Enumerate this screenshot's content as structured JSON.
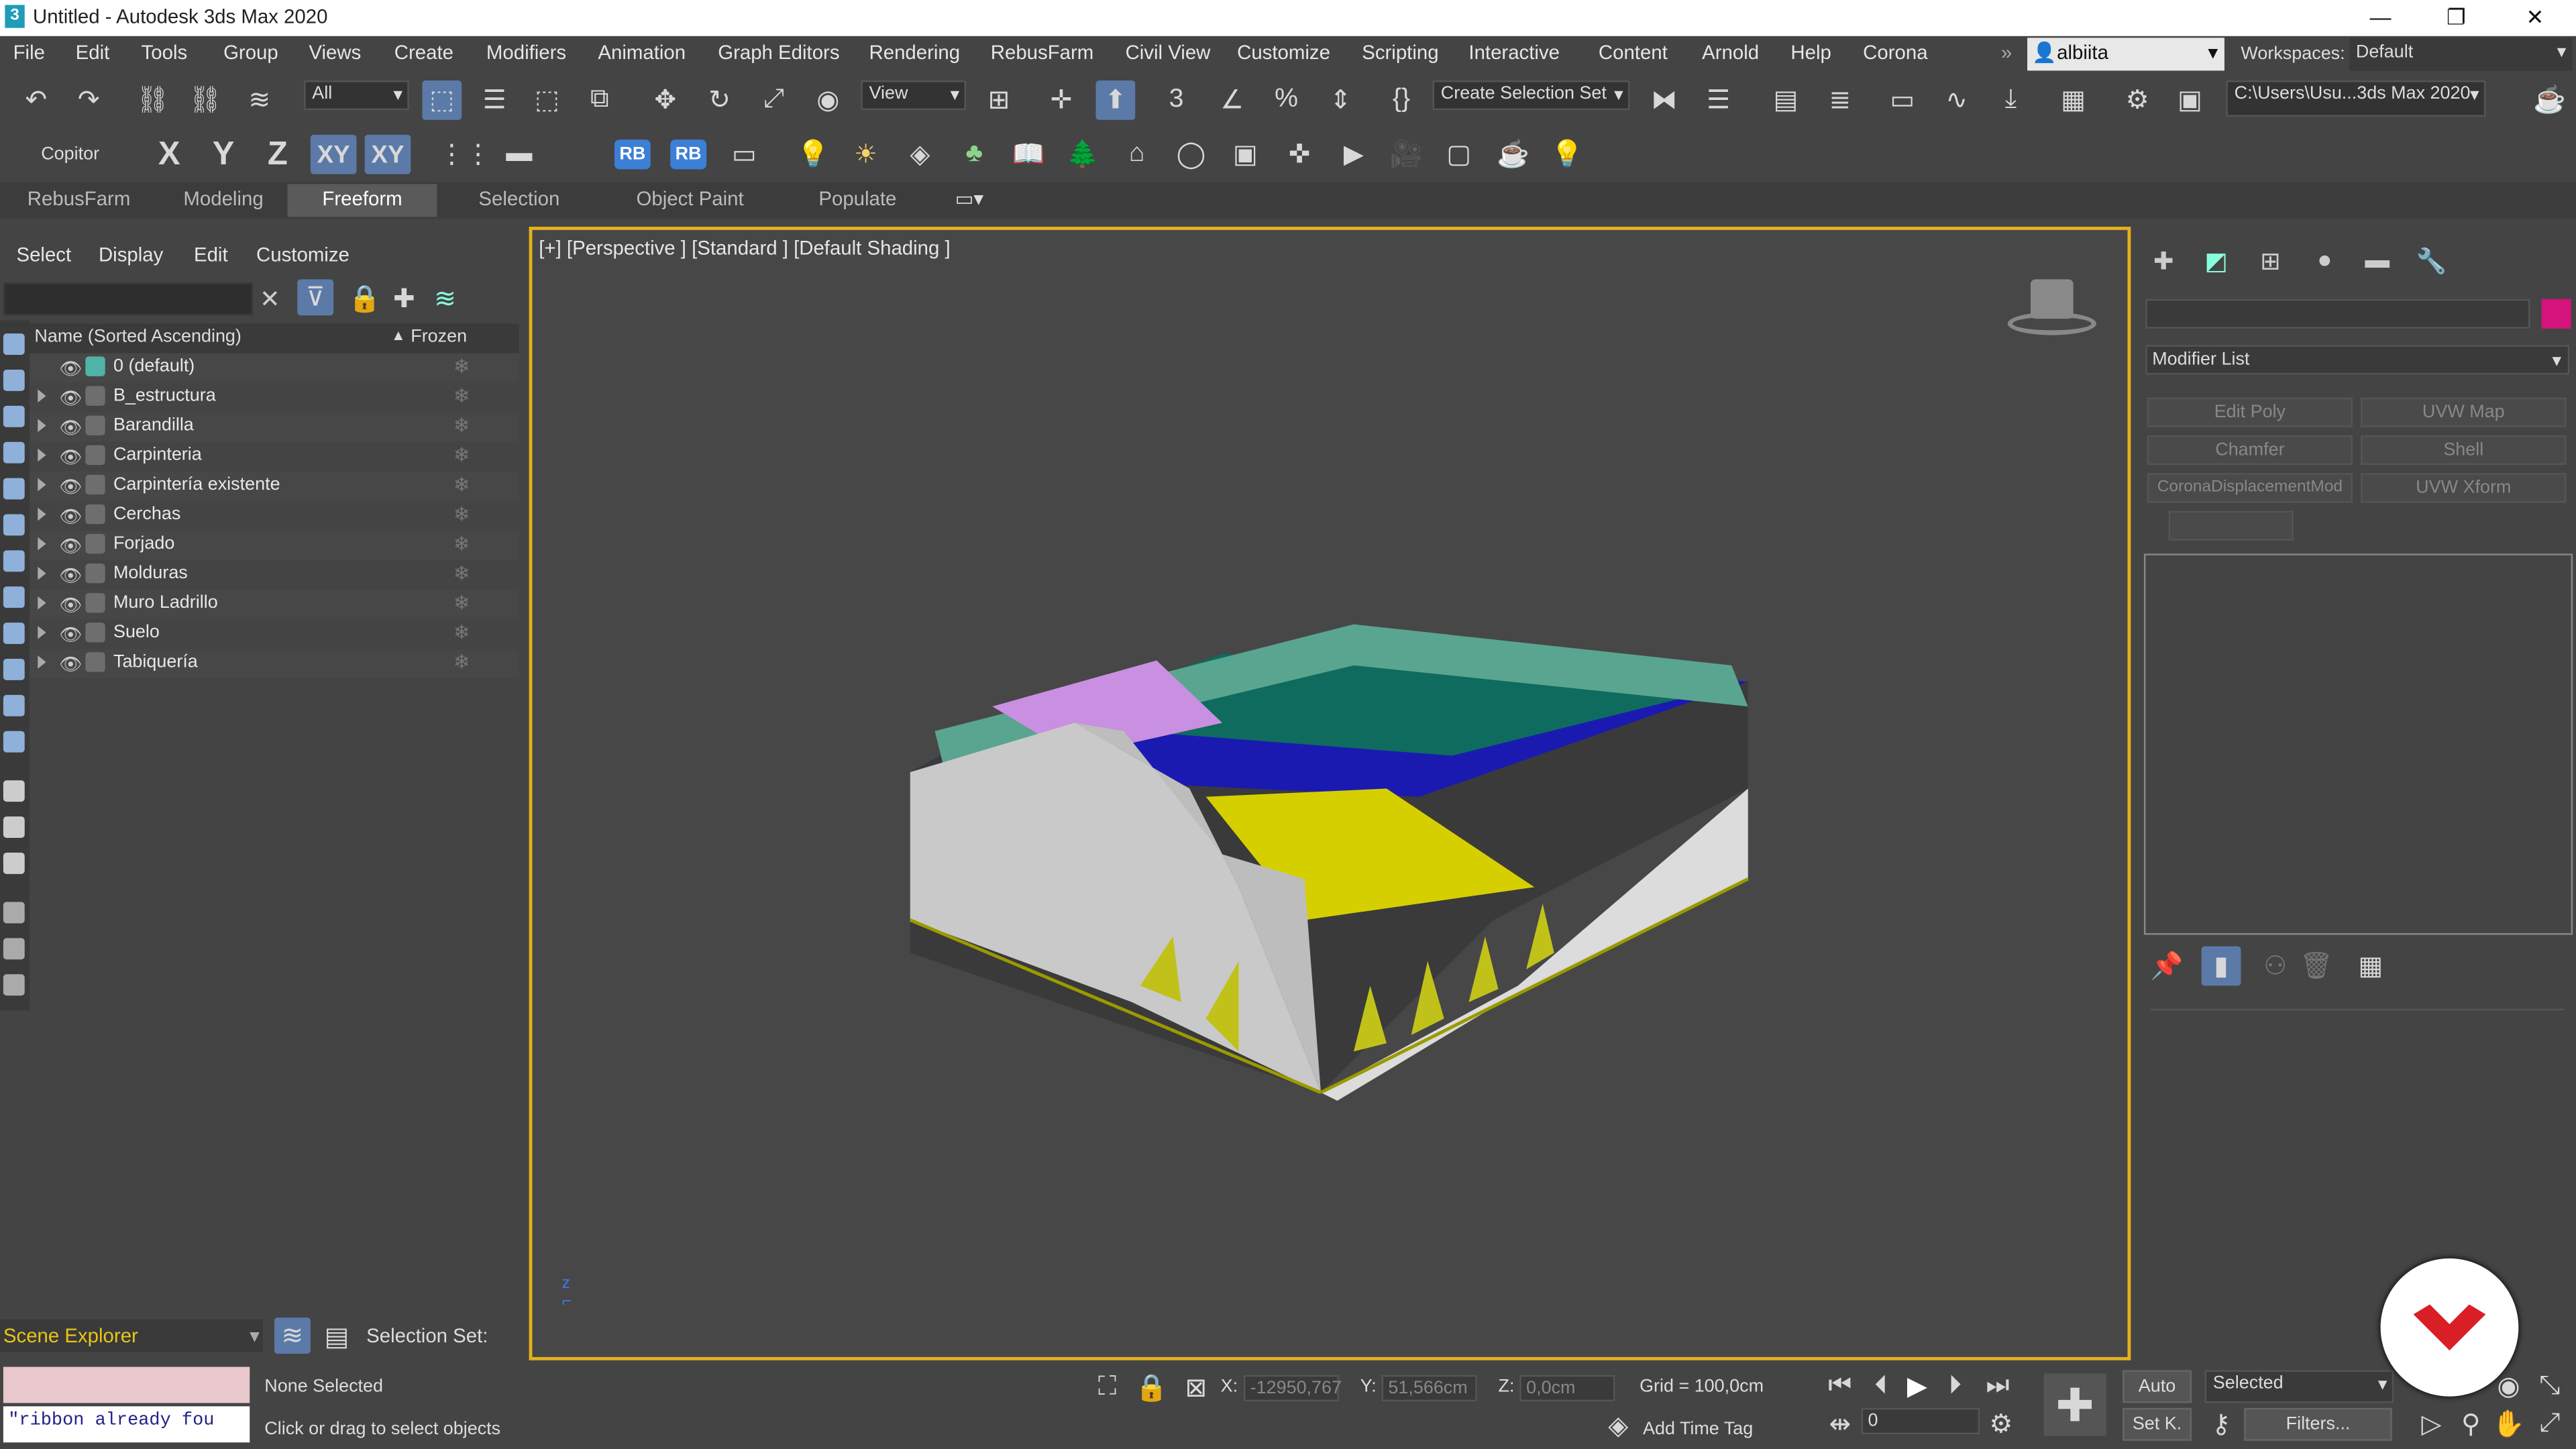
{
  "window": {
    "title": "Untitled - Autodesk 3ds Max 2020",
    "icon": "3ds-max-icon"
  },
  "menu": [
    "File",
    "Edit",
    "Tools",
    "Group",
    "Views",
    "Create",
    "Modifiers",
    "Animation",
    "Graph Editors",
    "Rendering",
    "RebusFarm",
    "Civil View",
    "Customize",
    "Scripting",
    "Interactive",
    "Content",
    "Arnold",
    "Help",
    "Corona"
  ],
  "user": {
    "name": "albiita"
  },
  "workspaces": {
    "label": "Workspaces:",
    "value": "Default"
  },
  "toolbar": {
    "filter": "All",
    "ref_coord": "View",
    "selection_set": "Create Selection Set",
    "project_path": "C:\\Users\\Usu...3ds Max 2020",
    "copitor": "Copitor",
    "axes": [
      "X",
      "Y",
      "Z",
      "XY",
      "XY"
    ],
    "rb1": "RB",
    "rb2": "RB"
  },
  "ribbon_tabs": [
    "RebusFarm",
    "Modeling",
    "Freeform",
    "Selection",
    "Object Paint",
    "Populate"
  ],
  "explorer": {
    "menu": [
      "Select",
      "Display",
      "Edit",
      "Customize"
    ],
    "col_name": "Name (Sorted Ascending)",
    "col_frozen": "Frozen",
    "rows": [
      "0 (default)",
      "B_estructura",
      "Barandilla",
      "Carpinteria",
      "Carpintería existente",
      "Cerchas",
      "Forjado",
      "Molduras",
      "Muro Ladrillo",
      "Suelo",
      "Tabiquería"
    ],
    "scene_explorer": "Scene Explorer",
    "selection_set": "Selection Set:"
  },
  "viewport": {
    "label": "[+] [Perspective ] [Standard ] [Default Shading ]"
  },
  "command_panel": {
    "modifier_list": "Modifier List",
    "buttons": [
      "Edit Poly",
      "UVW Map",
      "Chamfer",
      "Shell",
      "CoronaDisplacementMod",
      "UVW Xform"
    ],
    "color": "#d4147a"
  },
  "status": {
    "maxscript": "\"ribbon already fou",
    "selection": "None Selected",
    "prompt": "Click or drag to select objects",
    "x_label": "X:",
    "x": "-12950,767",
    "y_label": "Y:",
    "y": "51,566cm",
    "z_label": "Z:",
    "z": "0,0cm",
    "grid": "Grid = 100,0cm",
    "add_time_tag": "Add Time Tag",
    "auto": "Auto",
    "selected": "Selected",
    "frame": "0",
    "setk": "Set K.",
    "filters": "Filters..."
  },
  "colors": {
    "accent": "#e2b11e",
    "active": "#5b7aa8",
    "badge": "#d91f26"
  }
}
